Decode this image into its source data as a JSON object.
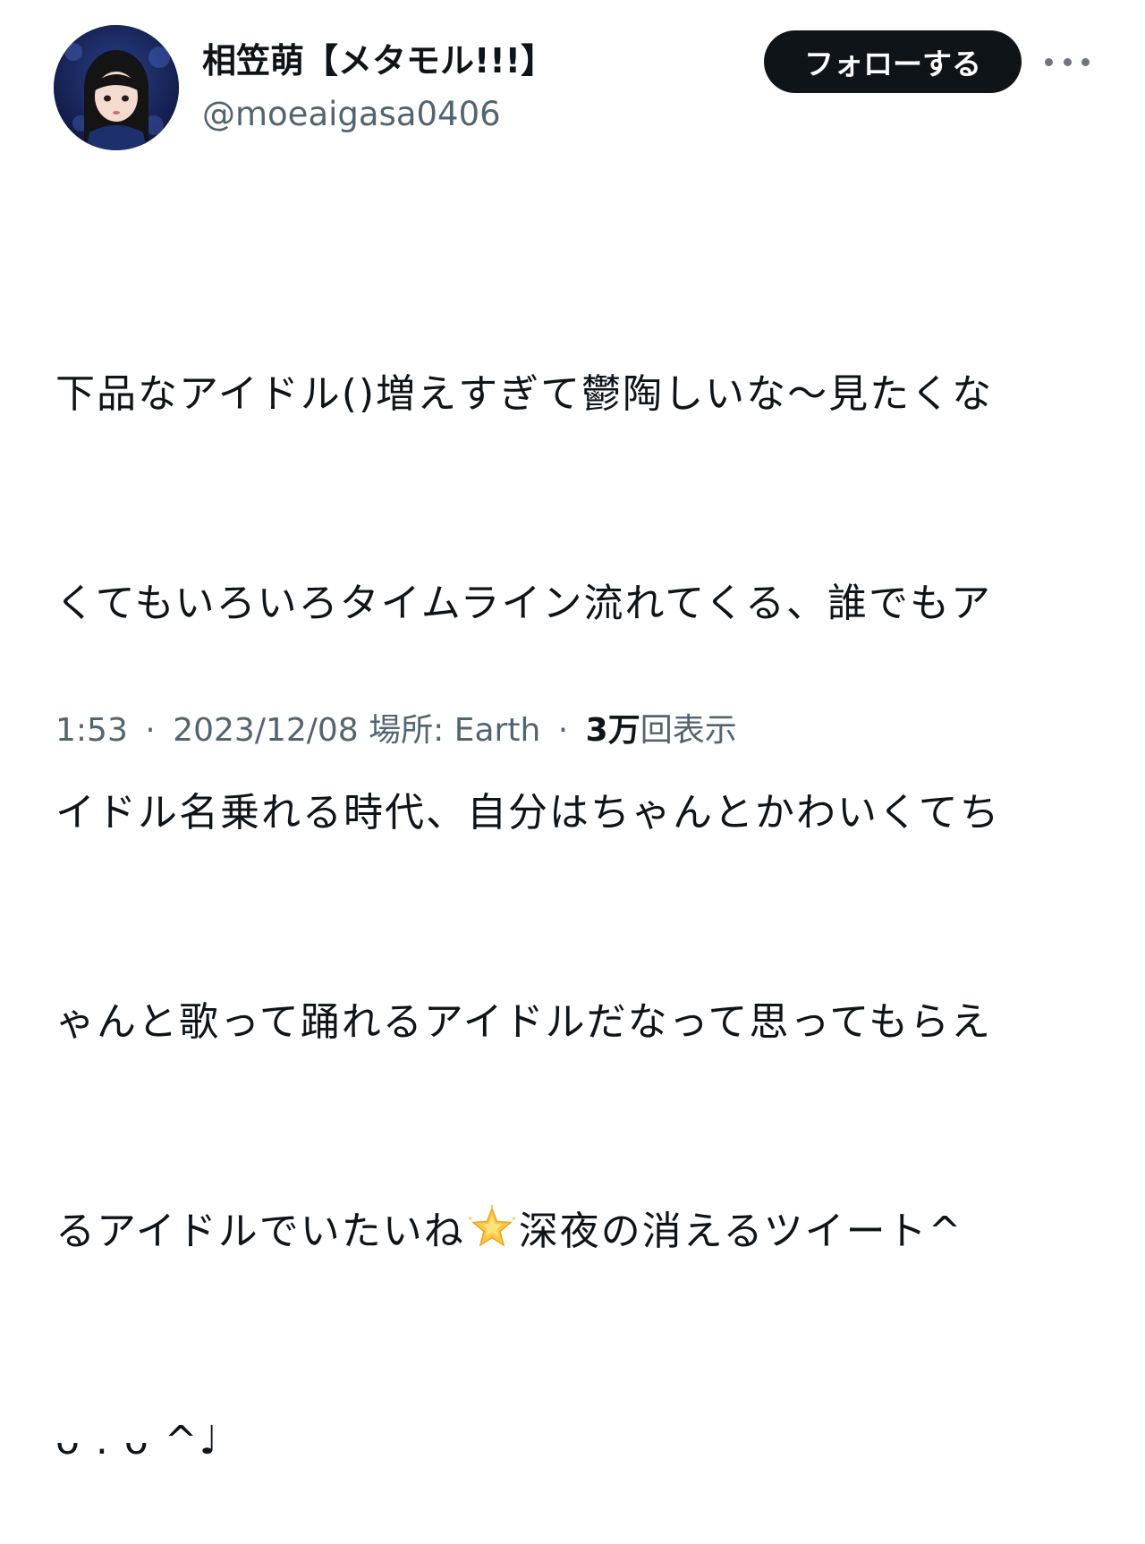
{
  "author": {
    "display_name": "相笠萌【メタモル!!!】",
    "handle": "@moeaigasa0406"
  },
  "actions": {
    "follow_label": "フォローする",
    "more_icon": "more-horizontal-icon"
  },
  "tweet": {
    "lines": [
      "下品なアイドル()増えすぎて鬱陶しいな〜見たくな",
      "くてもいろいろタイムライン流れてくる、誰でもア",
      "イドル名乗れる時代、自分はちゃんとかわいくてち",
      "ゃんと歌って踊れるアイドルだなって思ってもらえ"
    ],
    "line5_before_emoji": "るアイドルでいたいね",
    "emoji": "glowing-star-icon",
    "line5_after_emoji": "深夜の消えるツイート^",
    "line6": "ᴗ . ᴗ ^♩"
  },
  "meta": {
    "time": "1:53",
    "separator": "·",
    "date": "2023/12/08",
    "location": "場所: Earth",
    "views_count": "3万",
    "views_label": "回表示"
  },
  "colors": {
    "text_primary": "#0f1419",
    "text_secondary": "#536471",
    "follow_bg": "#0f1419",
    "follow_text": "#ffffff"
  }
}
